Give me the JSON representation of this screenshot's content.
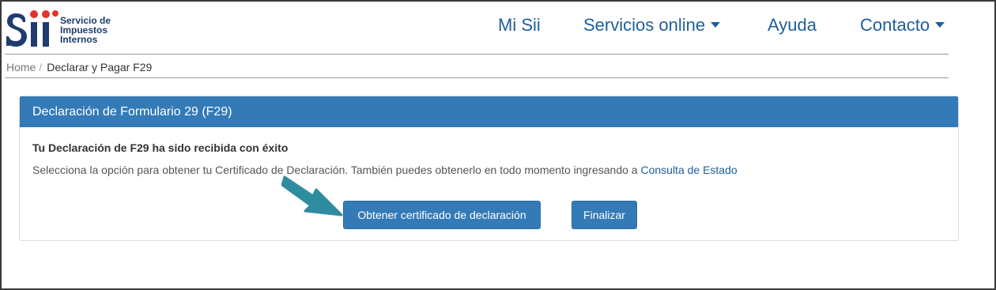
{
  "brand": {
    "logo_line1": "Servicio de",
    "logo_line2": "Impuestos",
    "logo_line3": "Internos",
    "logo_colors": {
      "blue": "#1e3c6e",
      "red": "#e2342d"
    }
  },
  "nav": {
    "items": [
      {
        "label": "Mi Sii"
      },
      {
        "label": "Servicios online",
        "has_dropdown": true
      },
      {
        "label": "Ayuda"
      },
      {
        "label": "Contacto",
        "has_dropdown": true
      }
    ]
  },
  "breadcrumb": {
    "home": "Home",
    "separator": "/",
    "current": "Declarar y Pagar F29"
  },
  "panel": {
    "title": "Declaración de Formulario 29 (F29)",
    "message_title": "Tu Declaración de F29 ha sido recibida con éxito",
    "message_text": "Selecciona la opción para obtener tu Certificado de Declaración. También puedes obtenerlo en todo momento ingresando a ",
    "message_link": "Consulta de Estado",
    "buttons": {
      "certificate": "Obtener certificado de declaración",
      "finish": "Finalizar"
    }
  },
  "colors": {
    "primary": "#337ab7",
    "nav_text": "#1f5f99",
    "arrow": "#2e8ca0"
  },
  "icons": {
    "annotation_arrow": "pointer-arrow-icon",
    "dropdown": "caret-down-icon"
  }
}
